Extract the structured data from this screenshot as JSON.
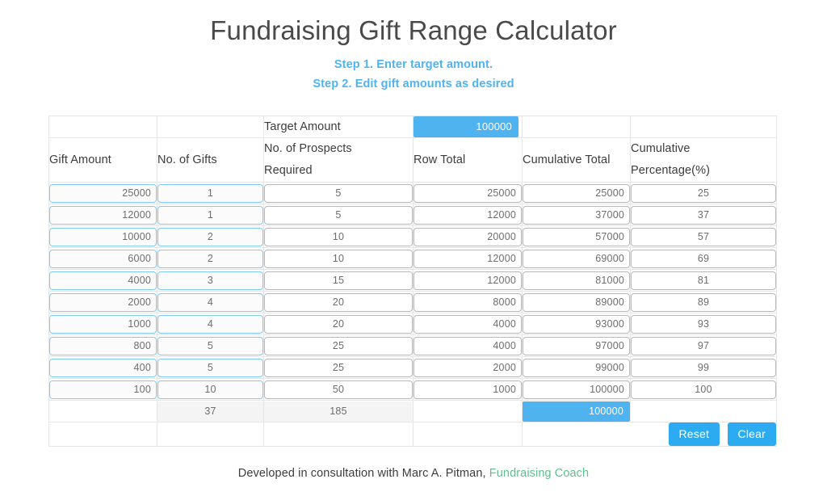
{
  "page": {
    "title": "Fundraising Gift Range Calculator",
    "steps": [
      "Step 1. Enter target amount.",
      "Step 2. Edit gift amounts as desired"
    ]
  },
  "target": {
    "label": "Target Amount",
    "value": "100000",
    "placeholder": "Target Amount"
  },
  "table": {
    "headers": [
      "Gift Amount",
      "No. of Gifts",
      "No. of Prospects Required",
      "Row Total",
      "Cumulative Total",
      "Cumulative Percentage(%)"
    ],
    "headers_lines": {
      "prospects_line1": "No. of Prospects",
      "prospects_line2": "Required",
      "cumpct_line1": "Cumulative",
      "cumpct_line2": "Percentage(%)"
    },
    "rows": [
      {
        "gift_amount": "25000",
        "no_of_gifts": "1",
        "prospects": "5",
        "row_total": "25000",
        "cumulative_total": "25000",
        "cumulative_pct": "25"
      },
      {
        "gift_amount": "12000",
        "no_of_gifts": "1",
        "prospects": "5",
        "row_total": "12000",
        "cumulative_total": "37000",
        "cumulative_pct": "37"
      },
      {
        "gift_amount": "10000",
        "no_of_gifts": "2",
        "prospects": "10",
        "row_total": "20000",
        "cumulative_total": "57000",
        "cumulative_pct": "57"
      },
      {
        "gift_amount": "6000",
        "no_of_gifts": "2",
        "prospects": "10",
        "row_total": "12000",
        "cumulative_total": "69000",
        "cumulative_pct": "69"
      },
      {
        "gift_amount": "4000",
        "no_of_gifts": "3",
        "prospects": "15",
        "row_total": "12000",
        "cumulative_total": "81000",
        "cumulative_pct": "81"
      },
      {
        "gift_amount": "2000",
        "no_of_gifts": "4",
        "prospects": "20",
        "row_total": "8000",
        "cumulative_total": "89000",
        "cumulative_pct": "89"
      },
      {
        "gift_amount": "1000",
        "no_of_gifts": "4",
        "prospects": "20",
        "row_total": "4000",
        "cumulative_total": "93000",
        "cumulative_pct": "93"
      },
      {
        "gift_amount": "800",
        "no_of_gifts": "5",
        "prospects": "25",
        "row_total": "4000",
        "cumulative_total": "97000",
        "cumulative_pct": "97"
      },
      {
        "gift_amount": "400",
        "no_of_gifts": "5",
        "prospects": "25",
        "row_total": "2000",
        "cumulative_total": "99000",
        "cumulative_pct": "99"
      },
      {
        "gift_amount": "100",
        "no_of_gifts": "10",
        "prospects": "50",
        "row_total": "1000",
        "cumulative_total": "100000",
        "cumulative_pct": "100"
      }
    ],
    "totals": {
      "no_of_gifts": "37",
      "prospects": "185",
      "cumulative_total": "100000"
    }
  },
  "buttons": {
    "reset": "Reset",
    "clear": "Clear"
  },
  "footer": {
    "text": "Developed in consultation with Marc A. Pitman,",
    "link": "Fundraising Coach"
  },
  "colors": {
    "accent_blue": "#4fb3f0",
    "button_blue": "#2cabf0",
    "input_blue_border": "#7fcbf4",
    "input_gray_border": "#b8b8b8",
    "link_green": "#5dc08e",
    "text_dark": "#3c3c3c",
    "title_gray": "#4a4a4a"
  }
}
